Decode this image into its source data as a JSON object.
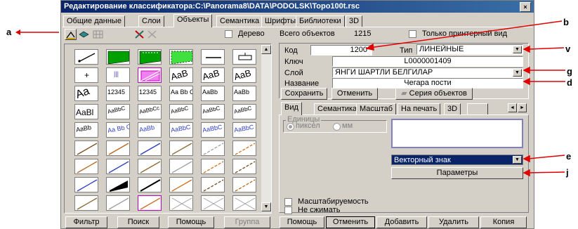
{
  "window": {
    "title": "Редактирование классификатора:C:\\Panorama8\\DATA\\PODOLSK\\Topo100t.rsc",
    "close_glyph": "×"
  },
  "tabs": [
    {
      "label": "Общие данные"
    },
    {
      "label": "Слои"
    },
    {
      "label": "Объекты",
      "active": true
    },
    {
      "label": "Семантика"
    },
    {
      "label": "Шрифты"
    },
    {
      "label": "Библиотеки"
    },
    {
      "label": "3D"
    }
  ],
  "toolbar": {
    "tree_label": "Дерево",
    "total_label": "Всего объектов",
    "total_value": "1215",
    "printer_only_label": "Только принтерный вид"
  },
  "object": {
    "code_label": "Код",
    "code_value": "1200",
    "type_label": "Тип",
    "type_value": "ЛИНЕЙНЫЕ",
    "key_label": "Ключ",
    "key_value": "L0000001409",
    "layer_label": "Слой",
    "layer_value": "ЯНГИ ШАРТЛИ БЕЛГИЛАР",
    "name_label": "Название",
    "name_value": "Чегара пости",
    "save_button": "Сохранить",
    "cancel_button": "Отменить",
    "series_button": "Серия объектов"
  },
  "view_tabs": [
    {
      "label": "Вид",
      "active": true
    },
    {
      "label": "Семантика"
    },
    {
      "label": "Масштаб"
    },
    {
      "label": "На печать"
    },
    {
      "label": "3D"
    }
  ],
  "view": {
    "units_label": "Единицы",
    "pixel_label": "пиксел",
    "mm_label": "мм",
    "sign_type_value": "Векторный знак",
    "params_button": "Параметры",
    "scalable_label": "Масштабируемость",
    "no_compress_label": "Не сжимать"
  },
  "grid_cells": [
    {
      "text": ""
    },
    {
      "text": ""
    },
    {
      "text": ""
    },
    {
      "text": ""
    },
    {
      "text": ""
    },
    {
      "text": ""
    },
    {
      "text": "+"
    },
    {
      "text": "|||"
    },
    {
      "text": ""
    },
    {
      "text": "AaB"
    },
    {
      "text": "AaB"
    },
    {
      "text": "AaB"
    },
    {
      "text": "Aa"
    },
    {
      "text": "12345"
    },
    {
      "text": "12345"
    },
    {
      "text": "Aa Bb C"
    },
    {
      "text": "AaBb"
    },
    {
      "text": "AaBb"
    },
    {
      "text": "AaBl"
    },
    {
      "text": "AaBbC"
    },
    {
      "text": "AaBbCc"
    },
    {
      "text": "AaBbC"
    },
    {
      "text": "AaBbC"
    },
    {
      "text": "AaBbC"
    },
    {
      "text": "AaBb"
    },
    {
      "text": "Aa Bb C"
    },
    {
      "text": "AaBb"
    },
    {
      "text": "AaBbC"
    },
    {
      "text": "AaBbC"
    },
    {
      "text": "AaBbC"
    }
  ],
  "bottom_left": {
    "filter_button": "Фильтр",
    "search_button": "Поиск",
    "help_button": "Помощь",
    "group_button": "Группа"
  },
  "bottom_right": {
    "help_button": "Помощь",
    "cancel_button": "Отменить",
    "add_button": "Добавить",
    "delete_button": "Удалить",
    "copy_button": "Копия"
  },
  "annotations": {
    "a": "a",
    "b": "b",
    "v": "v",
    "g": "g",
    "d": "d",
    "e": "e",
    "j": "j"
  },
  "colors": {
    "annotation_red": "#e00000",
    "title_blue": "#0a246a",
    "selection_blue": "#0a246a",
    "green": "#00a000",
    "light_green": "#40e040"
  }
}
